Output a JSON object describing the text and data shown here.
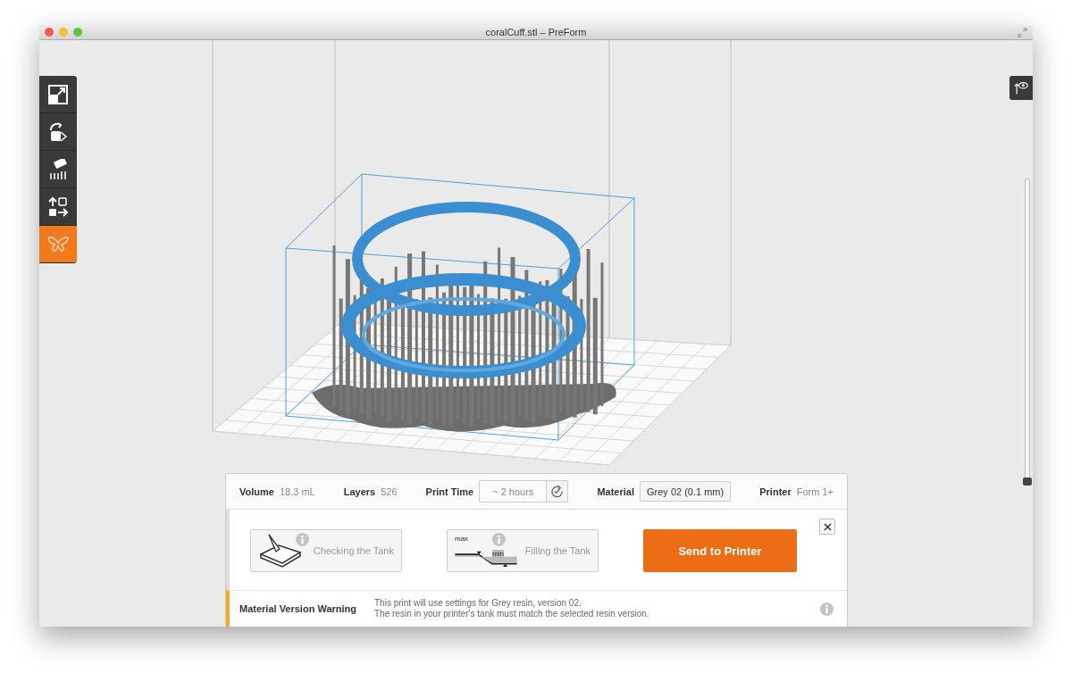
{
  "window": {
    "title": "coralCuff.stl – PreForm"
  },
  "toolbar": {
    "tools": [
      {
        "selected": false
      },
      {
        "selected": false
      },
      {
        "selected": false
      },
      {
        "selected": false
      },
      {
        "selected": true
      }
    ]
  },
  "summary": {
    "volume": {
      "label": "Volume",
      "value": "18.3 mL"
    },
    "layers": {
      "label": "Layers",
      "value": "526"
    },
    "print_time": {
      "label": "Print Time",
      "value": "~ 2 hours"
    },
    "material": {
      "label": "Material",
      "value": "Grey 02 (0.1 mm)"
    },
    "printer": {
      "label": "Printer",
      "value": "Form 1+"
    }
  },
  "steps": [
    {
      "kind": "tank-check",
      "label": "Checking the Tank"
    },
    {
      "kind": "tank-fill",
      "label": "Filling the Tank",
      "icon_labels": [
        "max",
        "min"
      ]
    }
  ],
  "layer_slider": {
    "level": 0
  },
  "send_button": "Send to Printer",
  "warning": {
    "title": "Material Version Warning",
    "lines": [
      "This print will use settings for Grey resin, version 02.",
      "The resin in your printer's tank must match the selected resin version."
    ]
  }
}
